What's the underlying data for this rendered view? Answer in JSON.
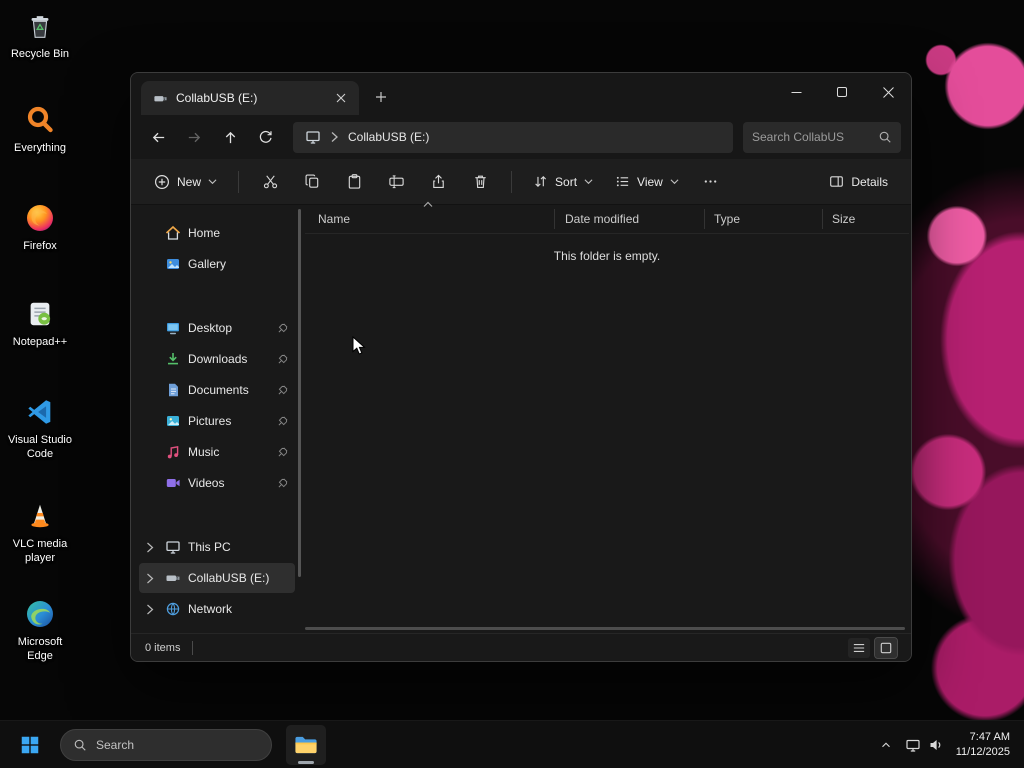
{
  "desktop": {
    "icons": [
      {
        "label": "Recycle Bin"
      },
      {
        "label": "Everything"
      },
      {
        "label": "Firefox"
      },
      {
        "label": "Notepad++"
      },
      {
        "label": "Visual Studio Code"
      },
      {
        "label": "VLC media player"
      },
      {
        "label": "Microsoft Edge"
      }
    ]
  },
  "explorer": {
    "tab_title": "CollabUSB (E:)",
    "breadcrumb": {
      "path": "CollabUSB (E:)"
    },
    "search_placeholder": "Search CollabUS",
    "toolbar": {
      "new_label": "New",
      "sort_label": "Sort",
      "view_label": "View",
      "details_label": "Details"
    },
    "columns": [
      "Name",
      "Date modified",
      "Type",
      "Size"
    ],
    "empty_message": "This folder is empty.",
    "sidebar": [
      {
        "label": "Home"
      },
      {
        "label": "Gallery"
      },
      {
        "label": "Desktop",
        "pinned": true
      },
      {
        "label": "Downloads",
        "pinned": true
      },
      {
        "label": "Documents",
        "pinned": true
      },
      {
        "label": "Pictures",
        "pinned": true
      },
      {
        "label": "Music",
        "pinned": true
      },
      {
        "label": "Videos",
        "pinned": true
      },
      {
        "label": "This PC",
        "expandable": true
      },
      {
        "label": "CollabUSB (E:)",
        "expandable": true,
        "selected": true
      },
      {
        "label": "Network",
        "expandable": true
      }
    ],
    "status": "0 items"
  },
  "taskbar": {
    "search_placeholder": "Search",
    "clock": {
      "time": "7:47 AM",
      "date": "11/12/2025"
    }
  },
  "colors": {
    "wallpaper_pink": "#c2186f",
    "window_bg": "#1f1f1f",
    "selection_bg": "#2f2f2f",
    "taskbar_bg": "#101010"
  }
}
